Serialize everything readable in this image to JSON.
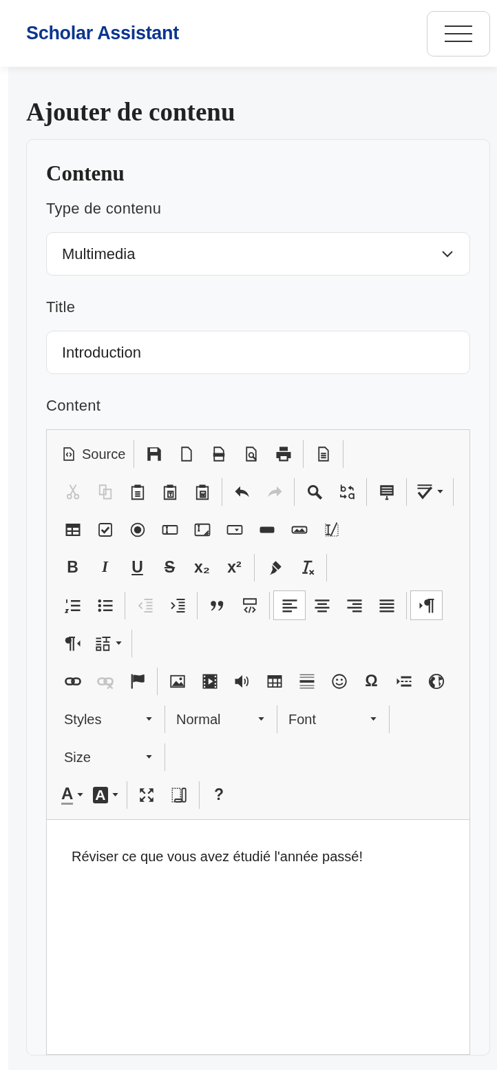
{
  "header": {
    "brand": "Scholar Assistant"
  },
  "page_title": "Ajouter de contenu",
  "card": {
    "title": "Contenu",
    "fields": [
      {
        "kind": "select",
        "label": "Type de contenu",
        "value": "Multimedia"
      },
      {
        "kind": "text",
        "label": "Title",
        "value": "Introduction"
      },
      {
        "kind": "editor",
        "label": "Content",
        "content": "Réviser ce que vous avez étudié l'année passé!",
        "toolbar": [
          {
            "end_rule": true,
            "groups": [
              [
                {
                  "kind": "labeled",
                  "label": "Source",
                  "disabled": false,
                  "selected": false
                }
              ],
              [
                {
                  "kind": "icon",
                  "disabled": false,
                  "selected": false
                },
                {
                  "kind": "icon",
                  "disabled": false,
                  "selected": false
                },
                {
                  "kind": "icon",
                  "disabled": false,
                  "selected": false
                },
                {
                  "kind": "icon",
                  "disabled": false,
                  "selected": false
                },
                {
                  "kind": "icon",
                  "disabled": false,
                  "selected": false
                }
              ],
              [
                {
                  "kind": "icon",
                  "disabled": false,
                  "selected": false
                }
              ]
            ]
          },
          {
            "end_rule": true,
            "groups": [
              [
                {
                  "kind": "icon",
                  "disabled": true,
                  "selected": false
                },
                {
                  "kind": "icon",
                  "disabled": true,
                  "selected": false
                },
                {
                  "kind": "icon",
                  "disabled": false,
                  "selected": false
                },
                {
                  "kind": "icon",
                  "disabled": false,
                  "selected": false
                },
                {
                  "kind": "icon",
                  "disabled": false,
                  "selected": false
                }
              ],
              [
                {
                  "kind": "icon",
                  "disabled": false,
                  "selected": false
                },
                {
                  "kind": "icon",
                  "disabled": true,
                  "selected": false
                }
              ],
              [
                {
                  "kind": "icon",
                  "disabled": false,
                  "selected": false
                },
                {
                  "kind": "icon",
                  "disabled": false,
                  "selected": false
                }
              ],
              [
                {
                  "kind": "icon",
                  "disabled": false,
                  "selected": false
                }
              ],
              [
                {
                  "kind": "menu",
                  "disabled": false,
                  "selected": false
                }
              ]
            ]
          },
          {
            "end_rule": false,
            "groups": [
              [
                {
                  "kind": "icon",
                  "disabled": false,
                  "selected": false
                },
                {
                  "kind": "icon",
                  "disabled": false,
                  "selected": false
                },
                {
                  "kind": "icon",
                  "disabled": false,
                  "selected": false
                },
                {
                  "kind": "icon",
                  "disabled": false,
                  "selected": false
                },
                {
                  "kind": "icon",
                  "disabled": false,
                  "selected": false
                },
                {
                  "kind": "icon",
                  "disabled": false,
                  "selected": false
                },
                {
                  "kind": "icon",
                  "disabled": false,
                  "selected": false
                },
                {
                  "kind": "icon",
                  "disabled": false,
                  "selected": false
                },
                {
                  "kind": "icon",
                  "disabled": false,
                  "selected": false
                }
              ]
            ]
          },
          {
            "end_rule": true,
            "groups": [
              [
                {
                  "kind": "glyph",
                  "text": "B",
                  "disabled": false,
                  "selected": false
                },
                {
                  "kind": "glyph",
                  "text": "I",
                  "disabled": false,
                  "selected": false
                },
                {
                  "kind": "glyph",
                  "text": "U",
                  "disabled": false,
                  "selected": false
                },
                {
                  "kind": "glyph",
                  "text": "S",
                  "disabled": false,
                  "selected": false
                },
                {
                  "kind": "glyph",
                  "text": "x₂",
                  "disabled": false,
                  "selected": false
                },
                {
                  "kind": "glyph",
                  "text": "x²",
                  "disabled": false,
                  "selected": false
                }
              ],
              [
                {
                  "kind": "icon",
                  "disabled": false,
                  "selected": false
                },
                {
                  "kind": "icon",
                  "disabled": false,
                  "selected": false
                }
              ]
            ]
          },
          {
            "end_rule": false,
            "groups": [
              [
                {
                  "kind": "icon",
                  "disabled": false,
                  "selected": false
                },
                {
                  "kind": "icon",
                  "disabled": false,
                  "selected": false
                }
              ],
              [
                {
                  "kind": "icon",
                  "disabled": true,
                  "selected": false
                },
                {
                  "kind": "icon",
                  "disabled": false,
                  "selected": false
                }
              ],
              [
                {
                  "kind": "icon",
                  "disabled": false,
                  "selected": false
                },
                {
                  "kind": "icon",
                  "disabled": false,
                  "selected": false
                }
              ],
              [
                {
                  "kind": "icon",
                  "disabled": false,
                  "selected": true
                },
                {
                  "kind": "icon",
                  "disabled": false,
                  "selected": false
                },
                {
                  "kind": "icon",
                  "disabled": false,
                  "selected": false
                },
                {
                  "kind": "icon",
                  "disabled": false,
                  "selected": false
                }
              ],
              [
                {
                  "kind": "icon",
                  "disabled": false,
                  "selected": true
                }
              ]
            ]
          },
          {
            "end_rule": true,
            "groups": [
              [
                {
                  "kind": "icon",
                  "disabled": false,
                  "selected": false
                },
                {
                  "kind": "menu",
                  "disabled": false,
                  "selected": false
                }
              ]
            ]
          },
          {
            "end_rule": false,
            "groups": [
              [
                {
                  "kind": "icon",
                  "disabled": false,
                  "selected": false
                },
                {
                  "kind": "icon",
                  "disabled": true,
                  "selected": false
                },
                {
                  "kind": "icon",
                  "disabled": false,
                  "selected": false
                }
              ],
              [
                {
                  "kind": "icon",
                  "disabled": false,
                  "selected": false
                },
                {
                  "kind": "icon",
                  "disabled": false,
                  "selected": false
                },
                {
                  "kind": "icon",
                  "disabled": false,
                  "selected": false
                },
                {
                  "kind": "icon",
                  "disabled": false,
                  "selected": false
                },
                {
                  "kind": "icon",
                  "disabled": false,
                  "selected": false
                },
                {
                  "kind": "icon",
                  "disabled": false,
                  "selected": false
                },
                {
                  "kind": "glyph",
                  "text": "Ω",
                  "disabled": false,
                  "selected": false
                },
                {
                  "kind": "icon",
                  "disabled": false,
                  "selected": false
                },
                {
                  "kind": "icon",
                  "disabled": false,
                  "selected": false
                }
              ]
            ]
          },
          {
            "end_rule": true,
            "groups": [
              [
                {
                  "kind": "combo",
                  "label": "Styles",
                  "disabled": false,
                  "selected": false
                }
              ],
              [
                {
                  "kind": "combo",
                  "label": "Normal",
                  "disabled": false,
                  "selected": false
                }
              ],
              [
                {
                  "kind": "combo",
                  "label": "Font",
                  "disabled": false,
                  "selected": false
                }
              ]
            ]
          },
          {
            "end_rule": true,
            "groups": [
              [
                {
                  "kind": "combo",
                  "label": "Size",
                  "disabled": false,
                  "selected": false
                }
              ]
            ]
          },
          {
            "end_rule": false,
            "groups": [
              [
                {
                  "kind": "fontcolor",
                  "text": "A",
                  "disabled": false,
                  "selected": false
                },
                {
                  "kind": "bgcolor",
                  "text": "A",
                  "disabled": false,
                  "selected": false
                }
              ],
              [
                {
                  "kind": "icon",
                  "disabled": false,
                  "selected": false
                },
                {
                  "kind": "icon",
                  "disabled": false,
                  "selected": false
                }
              ],
              [
                {
                  "kind": "glyph",
                  "text": "?",
                  "disabled": false,
                  "selected": false
                }
              ]
            ]
          }
        ]
      }
    ]
  }
}
